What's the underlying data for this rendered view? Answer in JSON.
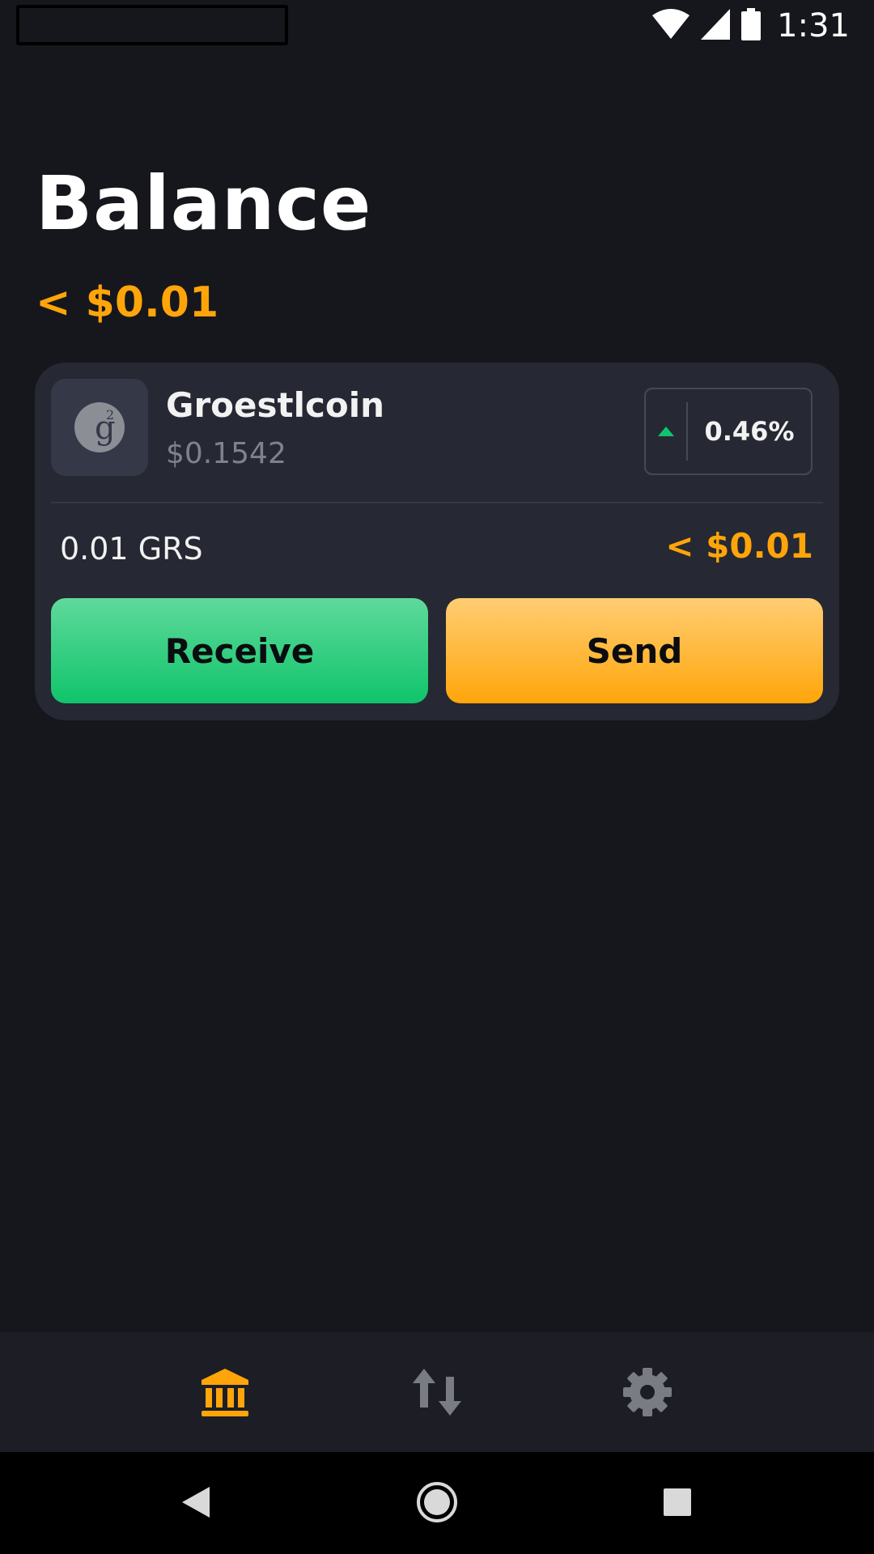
{
  "status_bar": {
    "time": "1:31",
    "icons": [
      "wifi-icon",
      "signal-icon",
      "battery-icon"
    ]
  },
  "page": {
    "title": "Balance",
    "total_balance": "< $0.01"
  },
  "coin": {
    "name": "Groestlcoin",
    "price": "$0.1542",
    "change": "0.46%",
    "change_direction": "up",
    "holding_amount": "0.01 GRS",
    "holding_value": "< $0.01",
    "receive_label": "Receive",
    "send_label": "Send"
  },
  "bottom_nav": {
    "items": [
      {
        "icon": "bank-icon",
        "active": true
      },
      {
        "icon": "transfer-arrows-icon",
        "active": false
      },
      {
        "icon": "gear-icon",
        "active": false
      }
    ]
  },
  "system_nav": {
    "items": [
      "back-icon",
      "home-icon",
      "recents-icon"
    ]
  },
  "colors": {
    "background": "#16171c",
    "card": "#262833",
    "accent_orange": "#ffa50a",
    "accent_green": "#10c46b",
    "inactive_icon": "#7a7c84"
  }
}
